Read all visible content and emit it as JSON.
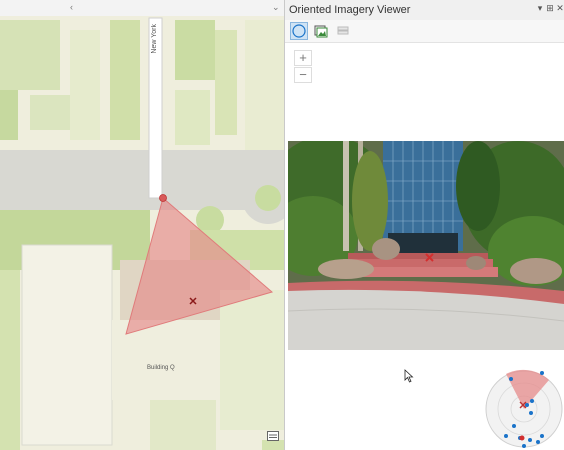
{
  "map": {
    "street_label": "New York",
    "building_label": "Building Q",
    "icons": {
      "camera_point": "camera-location-icon",
      "target": "target-x-icon",
      "overview": "map-overview-icon"
    }
  },
  "viewer": {
    "title": "Oriented Imagery Viewer",
    "header_controls": [
      "▾",
      "⊞",
      "✕"
    ],
    "toolbar": [
      {
        "name": "navigate-tool",
        "icon": "compass-icon",
        "active": true
      },
      {
        "name": "image-gallery-tool",
        "icon": "image-gallery-icon",
        "active": false
      },
      {
        "name": "layers-tool",
        "icon": "layers-icon",
        "active": false
      }
    ],
    "zoom": {
      "in": "+",
      "out": "−"
    }
  },
  "colors": {
    "accent": "#1a73c9",
    "footprint": "#e58b8b",
    "marker": "#d32f2f",
    "camera_dot": "#d95a5a"
  }
}
